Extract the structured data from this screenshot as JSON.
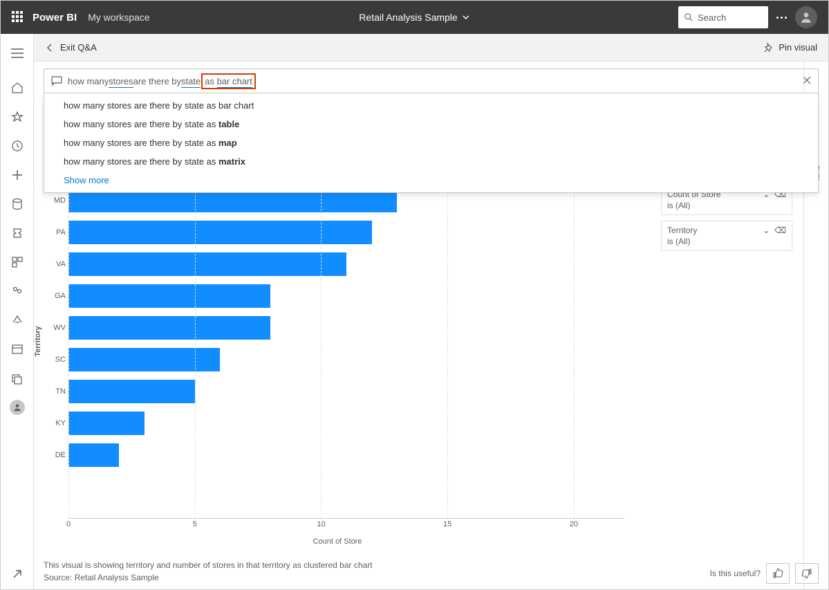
{
  "header": {
    "brand": "Power BI",
    "workspace": "My workspace",
    "dataset_name": "Retail Analysis Sample",
    "search_placeholder": "Search"
  },
  "subheader": {
    "exit_label": "Exit Q&A",
    "pin_label": "Pin visual"
  },
  "qna": {
    "query_prefix": "how many ",
    "query_underline1": "stores",
    "query_mid": " are there by ",
    "query_underline2": "state",
    "query_box_left": " as ",
    "query_box_right": "bar chart",
    "suggestions": [
      {
        "prefix": "how many stores are there by state as ",
        "bold": "bar chart"
      },
      {
        "prefix": "how many stores are there by state as ",
        "bold": "table"
      },
      {
        "prefix": "how many stores are there by state as ",
        "bold": "map"
      },
      {
        "prefix": "how many stores are there by state as ",
        "bold": "matrix"
      }
    ],
    "show_more": "Show more"
  },
  "chart_data": {
    "type": "bar",
    "orientation": "horizontal",
    "categories": [
      "MD",
      "PA",
      "VA",
      "GA",
      "WV",
      "SC",
      "TN",
      "KY",
      "DE"
    ],
    "values": [
      13,
      12,
      11,
      8,
      8,
      6,
      5,
      3,
      2
    ],
    "ylabel": "Territory",
    "xlabel": "Count of Store",
    "xlim": [
      0,
      22
    ],
    "x_ticks": [
      0,
      5,
      10,
      15,
      20
    ],
    "bar_color": "#118dff"
  },
  "filters": [
    {
      "name": "Count of Store",
      "value": "is (All)"
    },
    {
      "name": "Territory",
      "value": "is (All)"
    }
  ],
  "viz_panel_label": "ions",
  "footer": {
    "description": "This visual is showing territory and number of stores in that territory as clustered bar chart",
    "source": "Source: Retail Analysis Sample",
    "useful_label": "Is this useful?"
  }
}
